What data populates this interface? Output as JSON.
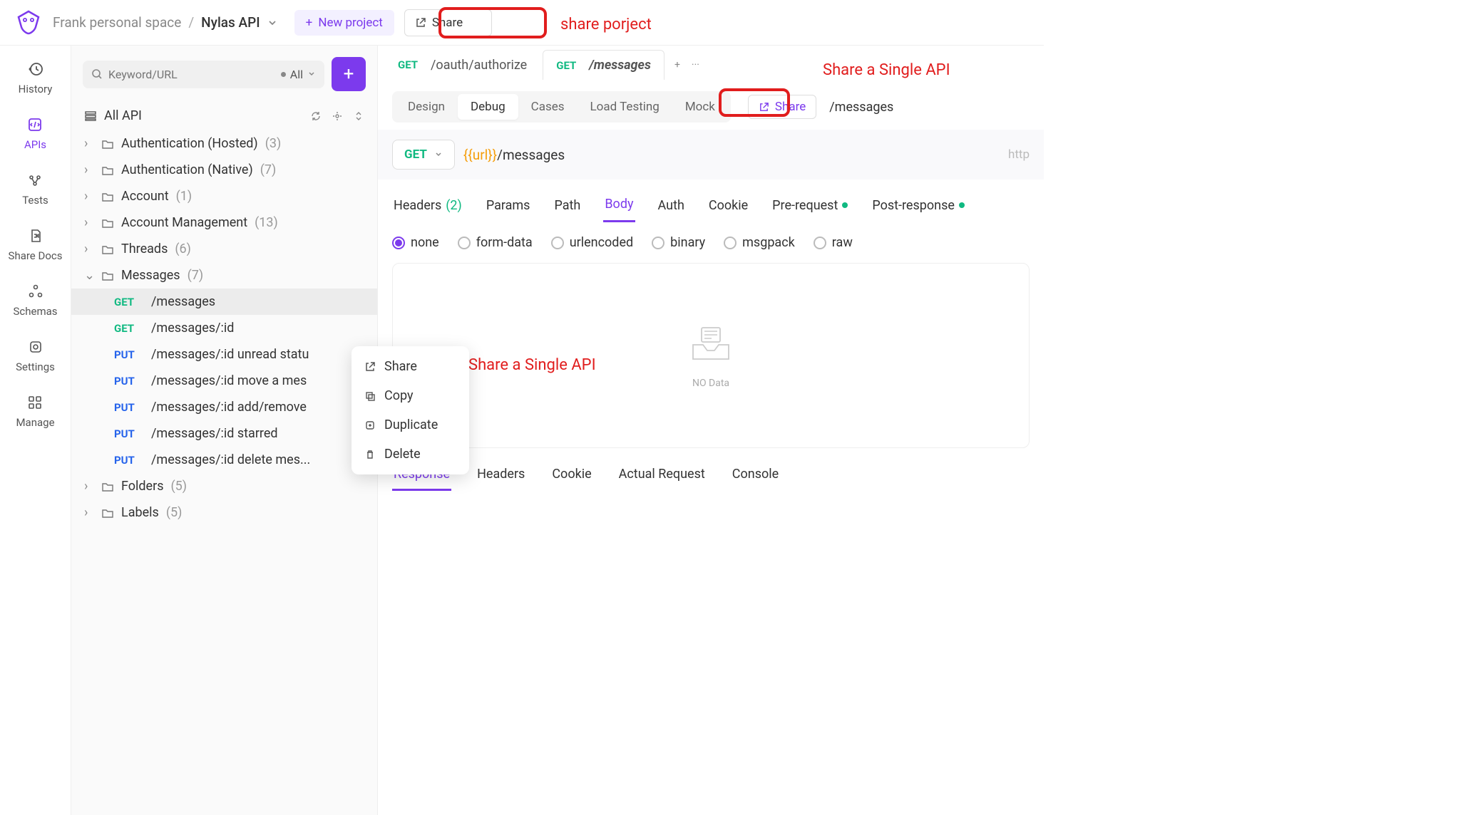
{
  "breadcrumb": {
    "space": "Frank personal space",
    "project": "Nylas API"
  },
  "topbar": {
    "new_project": "New project",
    "share": "Share"
  },
  "annotations": {
    "share_project": "share porject",
    "share_single_top": "Share a Single API",
    "share_single_ctx": "Share a Single API"
  },
  "rail": [
    {
      "id": "history",
      "label": "History"
    },
    {
      "id": "apis",
      "label": "APIs"
    },
    {
      "id": "tests",
      "label": "Tests"
    },
    {
      "id": "sharedocs",
      "label": "Share Docs"
    },
    {
      "id": "schemas",
      "label": "Schemas"
    },
    {
      "id": "settings",
      "label": "Settings"
    },
    {
      "id": "manage",
      "label": "Manage"
    }
  ],
  "search": {
    "placeholder": "Keyword/URL",
    "filter": "All"
  },
  "allapi": {
    "label": "All API"
  },
  "tree": [
    {
      "name": "Authentication (Hosted)",
      "count": "(3)",
      "open": false
    },
    {
      "name": "Authentication (Native)",
      "count": "(7)",
      "open": false
    },
    {
      "name": "Account",
      "count": "(1)",
      "open": false
    },
    {
      "name": "Account Management",
      "count": "(13)",
      "open": false
    },
    {
      "name": "Threads",
      "count": "(6)",
      "open": false
    },
    {
      "name": "Messages",
      "count": "(7)",
      "open": true,
      "items": [
        {
          "method": "GET",
          "path": "/messages",
          "selected": true
        },
        {
          "method": "GET",
          "path": "/messages/:id"
        },
        {
          "method": "PUT",
          "path": "/messages/:id unread statu"
        },
        {
          "method": "PUT",
          "path": "/messages/:id move a mes"
        },
        {
          "method": "PUT",
          "path": "/messages/:id add/remove"
        },
        {
          "method": "PUT",
          "path": "/messages/:id starred"
        },
        {
          "method": "PUT",
          "path": "/messages/:id delete mes..."
        }
      ]
    },
    {
      "name": "Folders",
      "count": "(5)",
      "open": false
    },
    {
      "name": "Labels",
      "count": "(5)",
      "open": false
    }
  ],
  "tabs": [
    {
      "method": "GET",
      "path": "/oauth/authorize",
      "active": false
    },
    {
      "method": "GET",
      "path": "/messages",
      "active": true
    }
  ],
  "subnav": {
    "items": [
      "Design",
      "Debug",
      "Cases",
      "Load Testing",
      "Mock"
    ],
    "active": "Debug",
    "share": "Share",
    "path": "/messages"
  },
  "url": {
    "method": "GET",
    "var": "{{url}}",
    "rest": "/messages",
    "proto": "http"
  },
  "req_tabs": {
    "items": [
      {
        "label": "Headers",
        "count": "(2)"
      },
      {
        "label": "Params"
      },
      {
        "label": "Path"
      },
      {
        "label": "Body",
        "active": true
      },
      {
        "label": "Auth"
      },
      {
        "label": "Cookie"
      },
      {
        "label": "Pre-request",
        "dot": true
      },
      {
        "label": "Post-response",
        "dot": true
      }
    ]
  },
  "body_types": {
    "options": [
      "none",
      "form-data",
      "urlencoded",
      "binary",
      "msgpack",
      "raw"
    ],
    "selected": "none"
  },
  "nodata": "NO Data",
  "resp_tabs": {
    "items": [
      "Response",
      "Headers",
      "Cookie",
      "Actual Request",
      "Console"
    ],
    "active": "Response"
  },
  "ctx_menu": {
    "items": [
      {
        "icon": "share",
        "label": "Share"
      },
      {
        "icon": "copy",
        "label": "Copy"
      },
      {
        "icon": "duplicate",
        "label": "Duplicate"
      },
      {
        "icon": "delete",
        "label": "Delete"
      }
    ]
  }
}
